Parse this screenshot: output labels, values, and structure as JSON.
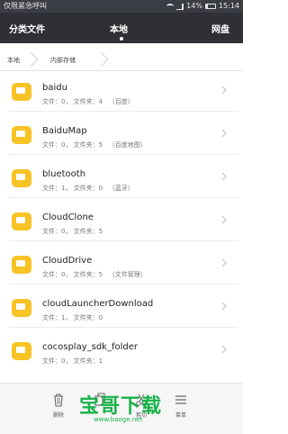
{
  "status_bar": {
    "carrier": "仅限紧急呼叫",
    "battery": "14%",
    "time": "15:14"
  },
  "tabs": [
    {
      "label": "分类文件",
      "active": false
    },
    {
      "label": "本地",
      "active": true
    },
    {
      "label": "网盘",
      "active": false
    }
  ],
  "breadcrumb": [
    "本地",
    "内部存储"
  ],
  "folders": [
    {
      "name": "baidu",
      "meta": "文件：0， 文件夹：4   （百度）"
    },
    {
      "name": "BaiduMap",
      "meta": "文件：0， 文件夹：5   （百度地图）"
    },
    {
      "name": "bluetooth",
      "meta": "文件：1， 文件夹：0   （蓝牙）"
    },
    {
      "name": "CloudClone",
      "meta": "文件：0， 文件夹：5"
    },
    {
      "name": "CloudDrive",
      "meta": "文件：0， 文件夹：5   （文件管理）"
    },
    {
      "name": "cloudLauncherDownload",
      "meta": "文件：1， 文件夹：0"
    },
    {
      "name": "cocosplay_sdk_folder",
      "meta": "文件：0， 文件夹：1"
    }
  ],
  "bottom_bar": {
    "delete_label": "删除",
    "copy_label": "",
    "cut_label": "剪切",
    "menu_label": "菜单"
  },
  "watermark": {
    "text": "宝哥下载",
    "url": "www.baoge.net"
  },
  "colors": {
    "tab_bar": "#2e3036",
    "folder": "#f7c325",
    "watermark": "#19b24b"
  }
}
